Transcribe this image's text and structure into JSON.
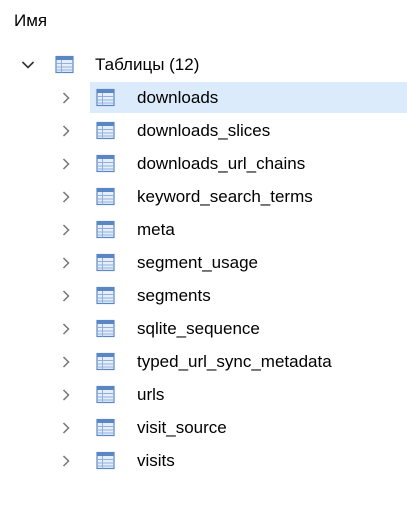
{
  "header": {
    "title": "Имя"
  },
  "root": {
    "label": "Таблицы (12)",
    "icon": "table-icon",
    "expanded": true
  },
  "tables": [
    {
      "label": "downloads",
      "selected": true
    },
    {
      "label": "downloads_slices"
    },
    {
      "label": "downloads_url_chains"
    },
    {
      "label": "keyword_search_terms"
    },
    {
      "label": "meta"
    },
    {
      "label": "segment_usage"
    },
    {
      "label": "segments"
    },
    {
      "label": "sqlite_sequence"
    },
    {
      "label": "typed_url_sync_metadata"
    },
    {
      "label": "urls"
    },
    {
      "label": "visit_source"
    },
    {
      "label": "visits"
    }
  ],
  "colors": {
    "selection": "#dcebfb",
    "icon_blue": "#5b86c4",
    "icon_fill": "#cfe0f5",
    "chevron": "#777777"
  }
}
